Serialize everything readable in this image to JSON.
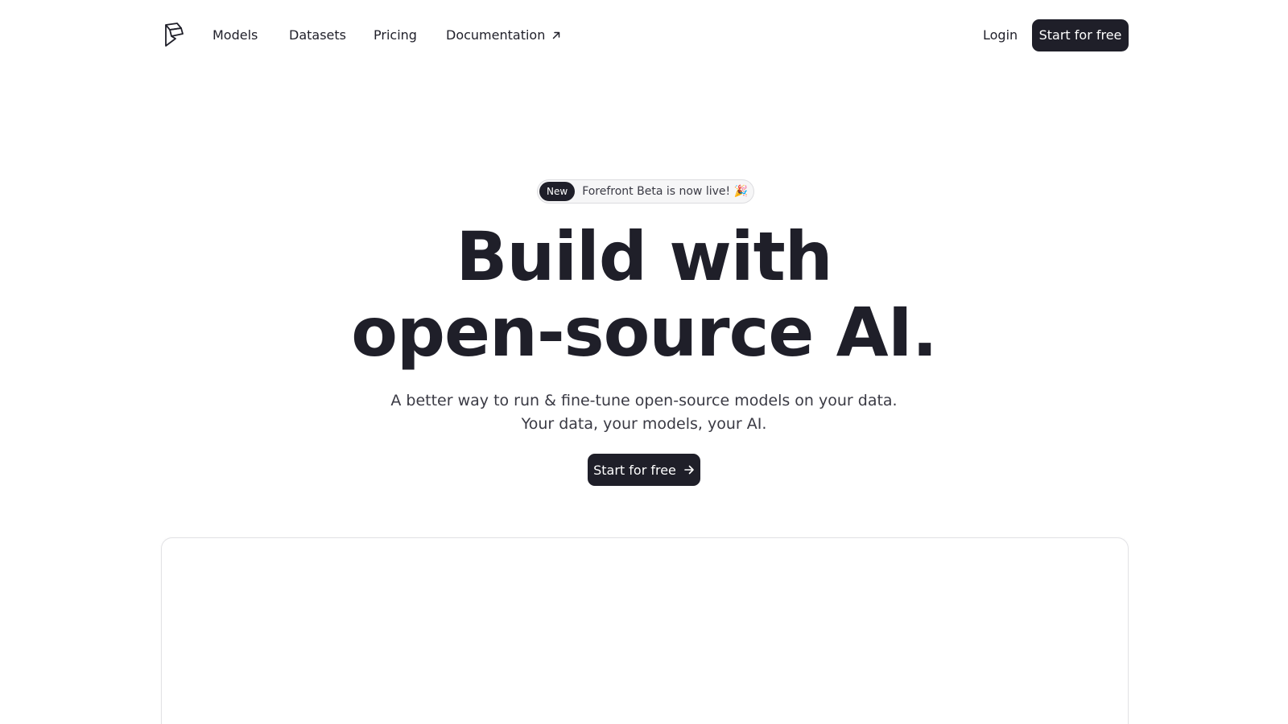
{
  "nav": {
    "links": [
      "Models",
      "Datasets",
      "Pricing",
      "Documentation"
    ],
    "login": "Login",
    "cta": "Start for free"
  },
  "announcement": {
    "badge": "New",
    "text": "Forefront Beta is now live! 🎉"
  },
  "hero": {
    "title_line1": "Build with",
    "title_line2": "open-source AI.",
    "subtitle_line1": "A better way to run & fine-tune open-source models on your data.",
    "subtitle_line2": "Your data, your models, your AI.",
    "cta": "Start for free"
  },
  "icons": {
    "logo": "forefront-logo-icon",
    "external": "arrow-up-right-icon",
    "chevron": "chevron-right-icon",
    "arrow": "arrow-right-icon"
  },
  "colors": {
    "primary": "#1f1f29",
    "text_secondary": "#3a3a44",
    "pill_bg": "#f6f6f7",
    "border": "#e2e2e5"
  }
}
